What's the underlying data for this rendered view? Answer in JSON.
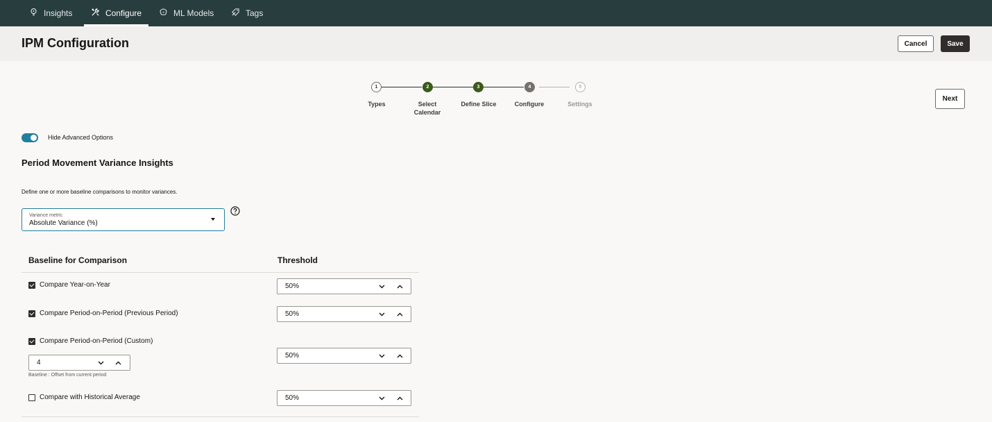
{
  "nav": {
    "tabs": [
      {
        "label": "Insights",
        "icon": "lightbulb-icon"
      },
      {
        "label": "Configure",
        "icon": "tools-icon",
        "active": true
      },
      {
        "label": "ML Models",
        "icon": "ml-brain-icon"
      },
      {
        "label": "Tags",
        "icon": "tag-icon"
      }
    ]
  },
  "header": {
    "title": "IPM Configuration",
    "cancel_label": "Cancel",
    "save_label": "Save"
  },
  "train": {
    "steps": [
      {
        "number": "1",
        "label": "Types",
        "state": "visited"
      },
      {
        "number": "2",
        "label": "Select\nCalendar",
        "state": "done"
      },
      {
        "number": "3",
        "label": "Define Slice",
        "state": "done"
      },
      {
        "number": "4",
        "label": "Configure",
        "state": "current"
      },
      {
        "number": "5",
        "label": "Settings",
        "state": "unvisited"
      }
    ],
    "next_label": "Next"
  },
  "advanced": {
    "toggle_label": "Hide Advanced Options",
    "on": true
  },
  "section": {
    "title": "Period Movement Variance Insights",
    "description": "Define one or more baseline comparisons to monitor variances."
  },
  "variance_metric": {
    "label": "Variance metric",
    "value": "Absolute Variance (%)"
  },
  "table": {
    "headers": {
      "baseline": "Baseline for Comparison",
      "threshold": "Threshold"
    },
    "rows": [
      {
        "label": "Compare Year-on-Year",
        "checked": true,
        "threshold": "50%"
      },
      {
        "label": "Compare Period-on-Period (Previous Period)",
        "checked": true,
        "threshold": "50%"
      },
      {
        "label": "Compare Period-on-Period (Custom)",
        "checked": true,
        "threshold": "50%",
        "offset": "4",
        "offset_helper": "Baseline : Offset from current period"
      },
      {
        "label": "Compare with Historical Average",
        "checked": false,
        "threshold": "50%"
      }
    ]
  },
  "colors": {
    "nav_bg": "#283d3e",
    "accent": "#227e9e",
    "done_step": "#3a5a1a",
    "primary_button": "#312d2a"
  }
}
